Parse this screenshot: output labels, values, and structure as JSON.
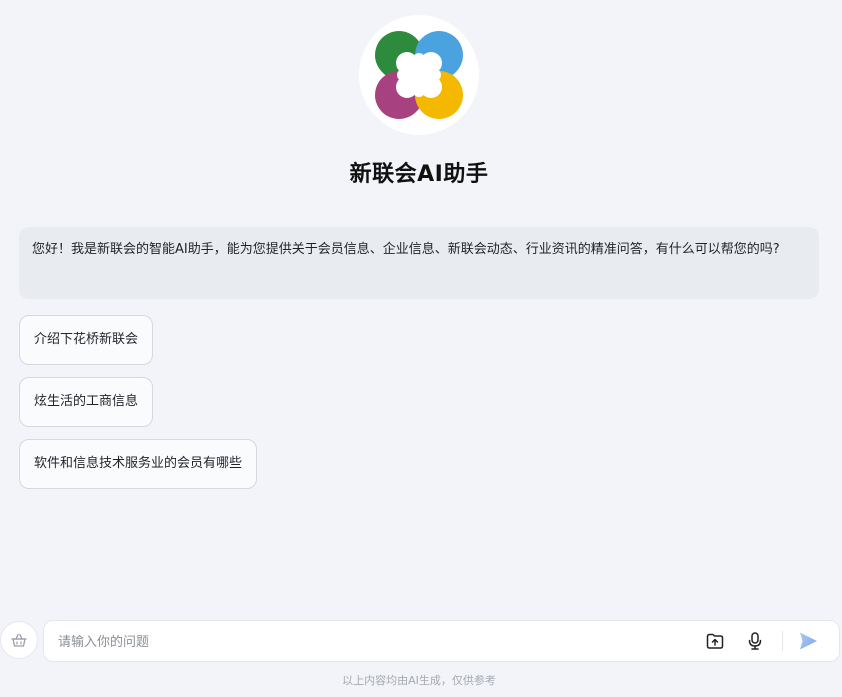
{
  "app": {
    "title": "新联会AI助手",
    "logo_icon": "four-people-circle-logo",
    "brand_colors": [
      "#2e8b3e",
      "#4aa3df",
      "#a8417f",
      "#f5b800"
    ]
  },
  "chat": {
    "greeting": "您好！我是新联会的智能AI助手，能为您提供关于会员信息、企业信息、新联会动态、行业资讯的精准问答，有什么可以帮您的吗?",
    "suggestions": [
      "介绍下花桥新联会",
      "炫生活的工商信息",
      "软件和信息技术服务业的会员有哪些"
    ]
  },
  "input": {
    "placeholder": "请输入你的问题",
    "value": "",
    "new_chat_icon": "basket-icon",
    "upload_icon": "upload-icon",
    "mic_icon": "microphone-icon",
    "send_icon": "send-icon",
    "send_color": "#8fb4f2"
  },
  "footer": {
    "disclaimer": "以上内容均由AI生成，仅供参考"
  }
}
